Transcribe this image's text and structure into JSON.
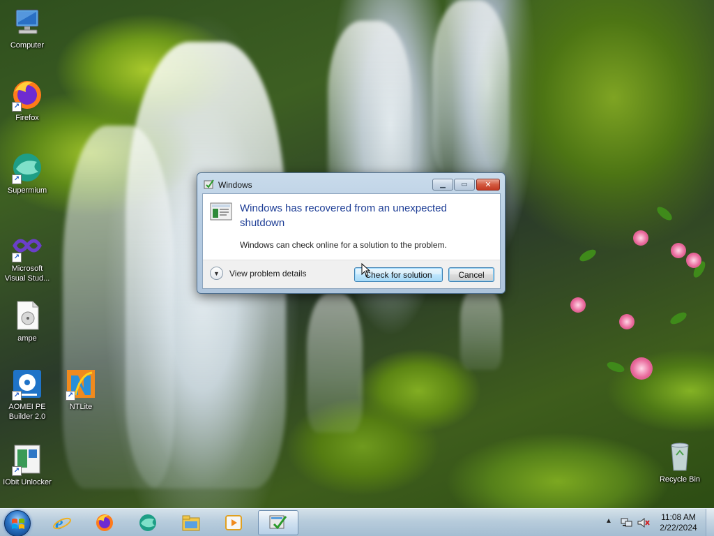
{
  "desktop": {
    "icons": [
      {
        "label": "Computer",
        "icon": "computer-icon"
      },
      {
        "label": "Firefox",
        "icon": "firefox-icon"
      },
      {
        "label": "Supermium",
        "icon": "supermium-icon"
      },
      {
        "label": "Microsoft Visual Stud...",
        "icon": "visual-studio-icon"
      },
      {
        "label": "ampe",
        "icon": "audio-file-icon"
      },
      {
        "label": "AOMEI PE Builder 2.0",
        "icon": "aomei-icon"
      },
      {
        "label": "NTLite",
        "icon": "ntlite-icon"
      },
      {
        "label": "IObit Unlocker",
        "icon": "iobit-unlocker-icon"
      },
      {
        "label": "Recycle Bin",
        "icon": "recycle-bin-icon"
      }
    ]
  },
  "dialog": {
    "title": "Windows",
    "heading": "Windows has recovered from an unexpected shutdown",
    "message": "Windows can check online for a solution to the problem.",
    "details_label": "View problem details",
    "primary_button": "Check for solution",
    "cancel_button": "Cancel",
    "caption_buttons": {
      "minimize": "▁",
      "maximize": "▭",
      "close": "✕"
    }
  },
  "taskbar": {
    "pinned": [
      {
        "icon": "internet-explorer-icon"
      },
      {
        "icon": "firefox-icon"
      },
      {
        "icon": "supermium-icon"
      },
      {
        "icon": "file-explorer-icon"
      },
      {
        "icon": "media-player-icon"
      },
      {
        "icon": "problem-reports-icon",
        "active": true
      }
    ],
    "tray": {
      "show_hidden": "▲"
    },
    "clock": {
      "time": "11:08 AM",
      "date": "2/22/2024"
    }
  },
  "colors": {
    "dialog_heading": "#1e3e96",
    "taskbar": "#bcd2e8",
    "close_button": "#c23a22"
  }
}
